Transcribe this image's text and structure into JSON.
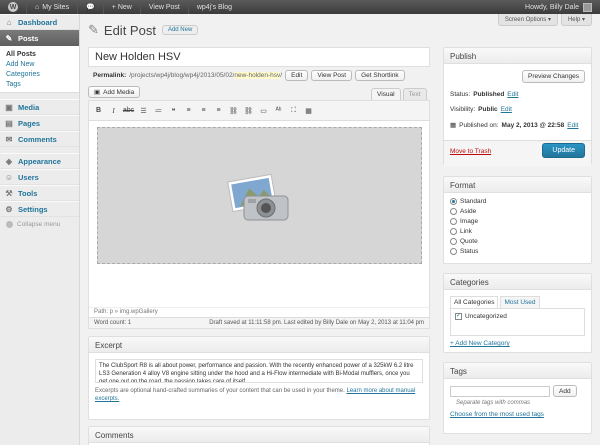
{
  "adminbar": {
    "my_sites": "My Sites",
    "new": "+ New",
    "view_post": "View Post",
    "site_name": "wp4j's Blog",
    "howdy": "Howdy, Billy Dale"
  },
  "sidebar": {
    "items": [
      {
        "label": "Dashboard",
        "icon": "dashboard-icon",
        "glyph": "⌂"
      },
      {
        "label": "Posts",
        "icon": "pushpin-icon",
        "glyph": "✎"
      },
      {
        "label": "Media",
        "icon": "media-icon",
        "glyph": "▣"
      },
      {
        "label": "Pages",
        "icon": "pages-icon",
        "glyph": "▤"
      },
      {
        "label": "Comments",
        "icon": "comments-icon",
        "glyph": "✉"
      },
      {
        "label": "Appearance",
        "icon": "appearance-icon",
        "glyph": "◈"
      },
      {
        "label": "Users",
        "icon": "users-icon",
        "glyph": "☺"
      },
      {
        "label": "Tools",
        "icon": "tools-icon",
        "glyph": "⚒"
      },
      {
        "label": "Settings",
        "icon": "settings-icon",
        "glyph": "⚙"
      }
    ],
    "posts_submenu": [
      "All Posts",
      "Add New",
      "Categories",
      "Tags"
    ],
    "collapse": "Collapse menu"
  },
  "header": {
    "title": "Edit Post",
    "add_new": "Add New",
    "screen_options": "Screen Options ▾",
    "help": "Help ▾"
  },
  "post": {
    "title": "New Holden HSV",
    "permalink_label": "Permalink:",
    "permalink_base": "/projects/wp4j/blog/wp4j/2013/05/02/",
    "permalink_slug": "new-holden-hsv",
    "permalink_tail": "/",
    "edit": "Edit",
    "view_post": "View Post",
    "get_shortlink": "Get Shortlink"
  },
  "editor": {
    "add_media": "Add Media",
    "tab_visual": "Visual",
    "tab_text": "Text",
    "path": "Path: p » img.wpGallery",
    "word_count": "Word count: 1",
    "draft_saved": "Draft saved at 11:11:58 pm. Last edited by Billy Dale on May 2, 2013 at 11:04 pm"
  },
  "excerpt": {
    "title": "Excerpt",
    "text": "The ClubSport R8 is all about power, performance and passion. With the recently enhanced power of a 325kW 6.2 litre LS3 Generation 4 alloy V8 engine sitting under the hood and a Hi-Flow intermediate with Bi-Modal mufflers, once you get one out on the road, the passion takes care of itself.",
    "help": "Excerpts are optional hand-crafted summaries of your content that can be used in your theme.",
    "help_link": "Learn more about manual excerpts."
  },
  "comments": {
    "title": "Comments"
  },
  "publish": {
    "title": "Publish",
    "preview": "Preview Changes",
    "status_label": "Status:",
    "status_value": "Published",
    "visibility_label": "Visibility:",
    "visibility_value": "Public",
    "published_label": "Published on:",
    "published_value": "May 2, 2013 @ 22:58",
    "edit": "Edit",
    "trash": "Move to Trash",
    "update": "Update"
  },
  "format": {
    "title": "Format",
    "options": [
      "Standard",
      "Aside",
      "Image",
      "Link",
      "Quote",
      "Status"
    ],
    "selected": "Standard"
  },
  "categories": {
    "title": "Categories",
    "tab_all": "All Categories",
    "tab_used": "Most Used",
    "items": [
      {
        "label": "Uncategorized",
        "checked": true
      }
    ],
    "add_new": "+ Add New Category"
  },
  "tags": {
    "title": "Tags",
    "add": "Add",
    "help": "Separate tags with commas",
    "choose": "Choose from the most used tags"
  }
}
